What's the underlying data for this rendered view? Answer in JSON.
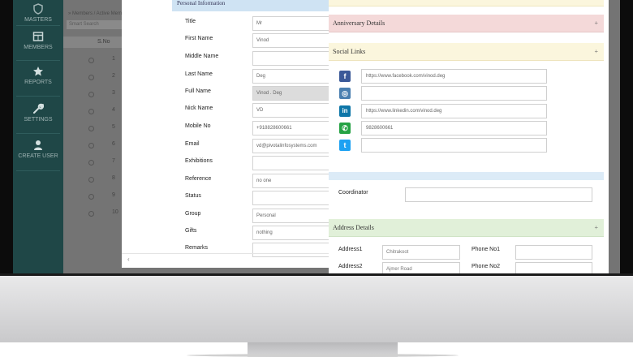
{
  "sidebar": {
    "items": [
      {
        "label": "MASTERS",
        "icon": "shield-icon"
      },
      {
        "label": "MEMBERS",
        "icon": "table-icon"
      },
      {
        "label": "REPORTS",
        "icon": "star-icon"
      },
      {
        "label": "SETTINGS",
        "icon": "wrench-icon"
      },
      {
        "label": "CREATE USER",
        "icon": "user-icon"
      }
    ]
  },
  "background_list": {
    "breadcrumb": "» Members / Active Members",
    "search_placeholder": "Smart Search",
    "column_header": "S.No",
    "row_numbers": [
      "1",
      "2",
      "3",
      "4",
      "5",
      "6",
      "7",
      "8",
      "9",
      "10"
    ]
  },
  "personal": {
    "header": "Personal Information",
    "fields": [
      {
        "label": "Title",
        "value": "Mr"
      },
      {
        "label": "First Name",
        "value": "Vinod"
      },
      {
        "label": "Middle Name",
        "value": ""
      },
      {
        "label": "Last Name",
        "value": "Deg"
      },
      {
        "label": "Full Name",
        "value": "Vinod . Deg"
      },
      {
        "label": "Nick Name",
        "value": "VD"
      },
      {
        "label": "Mobile No",
        "value": "+918828600661"
      },
      {
        "label": "Email",
        "value": "vd@pivotalinfosystems.com"
      },
      {
        "label": "Exhibitions",
        "value": ""
      },
      {
        "label": "Reference",
        "value": "no one"
      },
      {
        "label": "Status",
        "value": ""
      },
      {
        "label": "Group",
        "value": "Personal"
      },
      {
        "label": "Gifts",
        "value": "nothing"
      },
      {
        "label": "Remarks",
        "value": ""
      }
    ]
  },
  "anniversary": {
    "header": "Anniversary Details",
    "plus": "+"
  },
  "social": {
    "header": "Social Links",
    "plus": "+",
    "links": [
      {
        "icon": "facebook-icon",
        "glyph": "f",
        "color": "#3b5998",
        "value": "https://www.facebook.com/vinod.deg"
      },
      {
        "icon": "instagram-icon",
        "glyph": "◎",
        "color": "#4a7fb0",
        "value": ""
      },
      {
        "icon": "linkedin-icon",
        "glyph": "in",
        "color": "#0e76a8",
        "value": "https://www.linkedin.com/vinod.deg"
      },
      {
        "icon": "whatsapp-icon",
        "glyph": "✆",
        "color": "#25a244",
        "value": "9828600661"
      },
      {
        "icon": "twitter-icon",
        "glyph": "t",
        "color": "#1da1f2",
        "value": ""
      }
    ]
  },
  "coordinator": {
    "label": "Coordinator",
    "value": ""
  },
  "address": {
    "header": "Address Details",
    "plus": "+",
    "address1_label": "Address1",
    "address1_value": "Chitrakoot",
    "address2_label": "Address2",
    "address2_value": "Ajmer Road",
    "phone1_label": "Phone No1",
    "phone2_label": "Phone No2"
  },
  "modal_scroll_arrow": "‹",
  "colors": {
    "sidebar": "#1f4747",
    "personal_header": "#cfe3f3",
    "anniversary_header": "#f4d9d9",
    "social_header": "#fbf6dd",
    "coordinator_header": "#dcebf7",
    "address_header": "#e1f0d9"
  }
}
